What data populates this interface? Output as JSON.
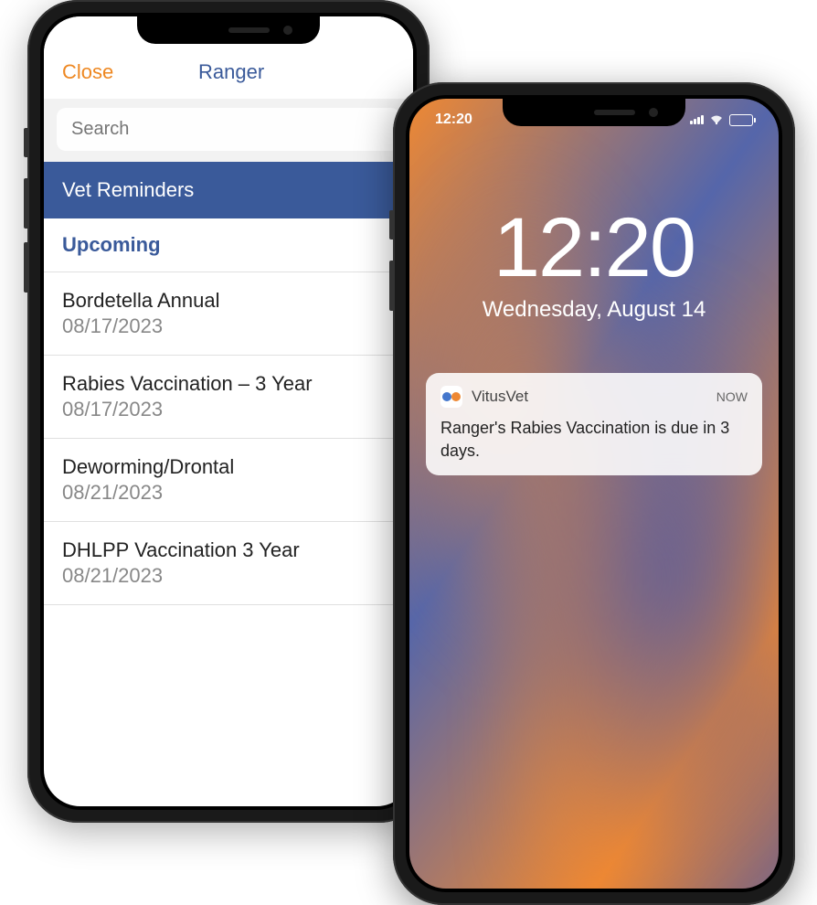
{
  "app": {
    "header": {
      "close_label": "Close",
      "title": "Ranger"
    },
    "search": {
      "placeholder": "Search"
    },
    "section_title": "Vet Reminders",
    "subsection_title": "Upcoming",
    "reminders": [
      {
        "title": "Bordetella Annual",
        "date": "08/17/2023"
      },
      {
        "title": "Rabies Vaccination – 3 Year",
        "date": "08/17/2023"
      },
      {
        "title": "Deworming/Drontal",
        "date": "08/21/2023"
      },
      {
        "title": "DHLPP Vaccination 3 Year",
        "date": "08/21/2023"
      }
    ]
  },
  "lockscreen": {
    "status_time": "12:20",
    "clock": "12:20",
    "date": "Wednesday, August 14",
    "notification": {
      "app_name": "VitusVet",
      "time": "NOW",
      "body": "Ranger's Rabies Vaccination is due in 3 days."
    }
  }
}
